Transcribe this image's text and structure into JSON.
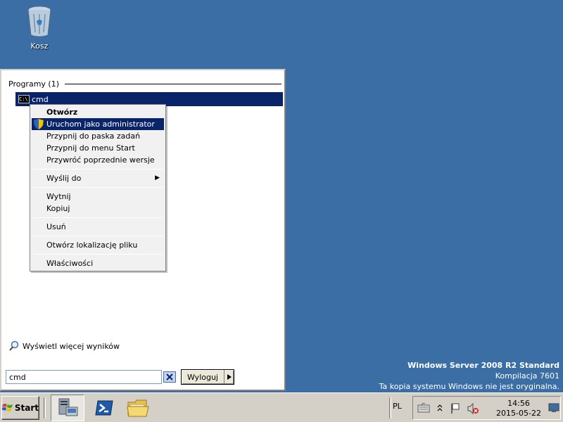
{
  "desktop": {
    "recycle_bin_label": "Kosz"
  },
  "start_menu": {
    "section_header": "Programy (1)",
    "result_label": "cmd",
    "more_results": "Wyświetl więcej wyników",
    "search_value": "cmd",
    "logoff_label": "Wyloguj"
  },
  "context_menu": {
    "open": "Otwórz",
    "run_as_admin": "Uruchom jako administrator",
    "pin_taskbar": "Przypnij do paska zadań",
    "pin_start": "Przypnij do menu Start",
    "restore_versions": "Przywróć poprzednie wersje",
    "send_to": "Wyślij do",
    "cut": "Wytnij",
    "copy": "Kopiuj",
    "delete": "Usuń",
    "open_location": "Otwórz lokalizację pliku",
    "properties": "Właściwości"
  },
  "watermark": {
    "line1": "Windows Server 2008 R2 Standard",
    "line2": "Kompilacja 7601",
    "line3": "Ta kopia systemu Windows nie jest oryginalna."
  },
  "taskbar": {
    "start_label": "Start",
    "language": "PL",
    "time": "14:56",
    "date": "2015-05-22"
  },
  "colors": {
    "desktop": "#3a6ea5",
    "selection": "#0a246a",
    "panel": "#d4d0c8"
  }
}
